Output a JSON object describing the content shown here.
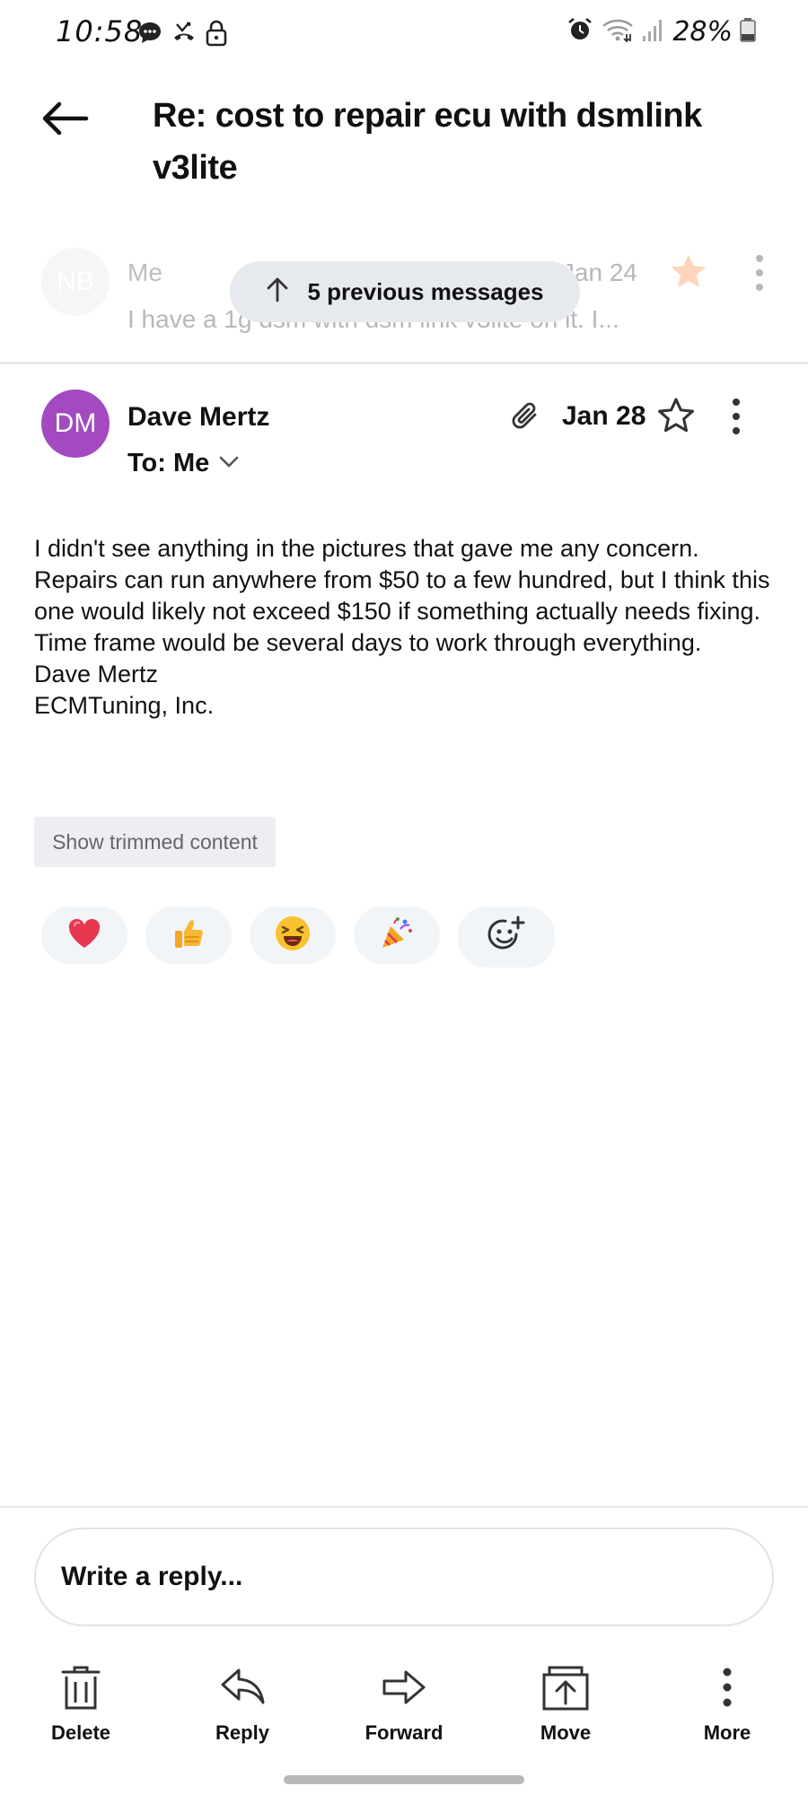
{
  "status_bar": {
    "time": "10:58",
    "battery": "28%",
    "icons": [
      "chat-bubble-icon",
      "missed-call-icon",
      "lock-icon",
      "alarm-icon",
      "wifi-icon",
      "signal-icon",
      "battery-icon"
    ]
  },
  "header": {
    "back_icon": "arrow-left-icon",
    "subject": "Re: cost to repair ecu with dsmlink v3lite"
  },
  "previous_message": {
    "avatar_initials": "NB",
    "from": "Me",
    "date": "Jan 24",
    "snippet": "I have a 1g dsm with dsm link v3lite on it. I...",
    "starred": true,
    "star_color": "#f7883b"
  },
  "previous_pill": {
    "label": "5 previous messages"
  },
  "message": {
    "avatar_initials": "DM",
    "avatar_color": "#a34ac0",
    "sender": "Dave Mertz",
    "to_label": "To: Me",
    "date": "Jan 28",
    "has_attachment": true,
    "starred": false,
    "body": "I didn't see anything in the pictures that gave me any concern. Repairs can run anywhere from $50 to a few hundred, but I think this one would likely not exceed $150 if something actually needs fixing.  Time frame would be several days to work through everything.",
    "signature_name": "Dave Mertz",
    "signature_company": "ECMTuning, Inc.",
    "trimmed_label": "Show trimmed content"
  },
  "reactions": [
    {
      "emoji": "❤️",
      "name": "heart-reaction"
    },
    {
      "emoji": "👍",
      "name": "thumbs-up-reaction"
    },
    {
      "emoji": "😆",
      "name": "laughing-reaction"
    },
    {
      "emoji": "🎉",
      "name": "party-reaction"
    },
    {
      "emoji": "",
      "name": "add-reaction"
    }
  ],
  "reply": {
    "placeholder": "Write a reply..."
  },
  "actions": [
    {
      "label": "Delete",
      "icon": "trash-icon"
    },
    {
      "label": "Reply",
      "icon": "reply-icon"
    },
    {
      "label": "Forward",
      "icon": "forward-icon"
    },
    {
      "label": "Move",
      "icon": "move-icon"
    },
    {
      "label": "More",
      "icon": "more-vertical-icon"
    }
  ]
}
